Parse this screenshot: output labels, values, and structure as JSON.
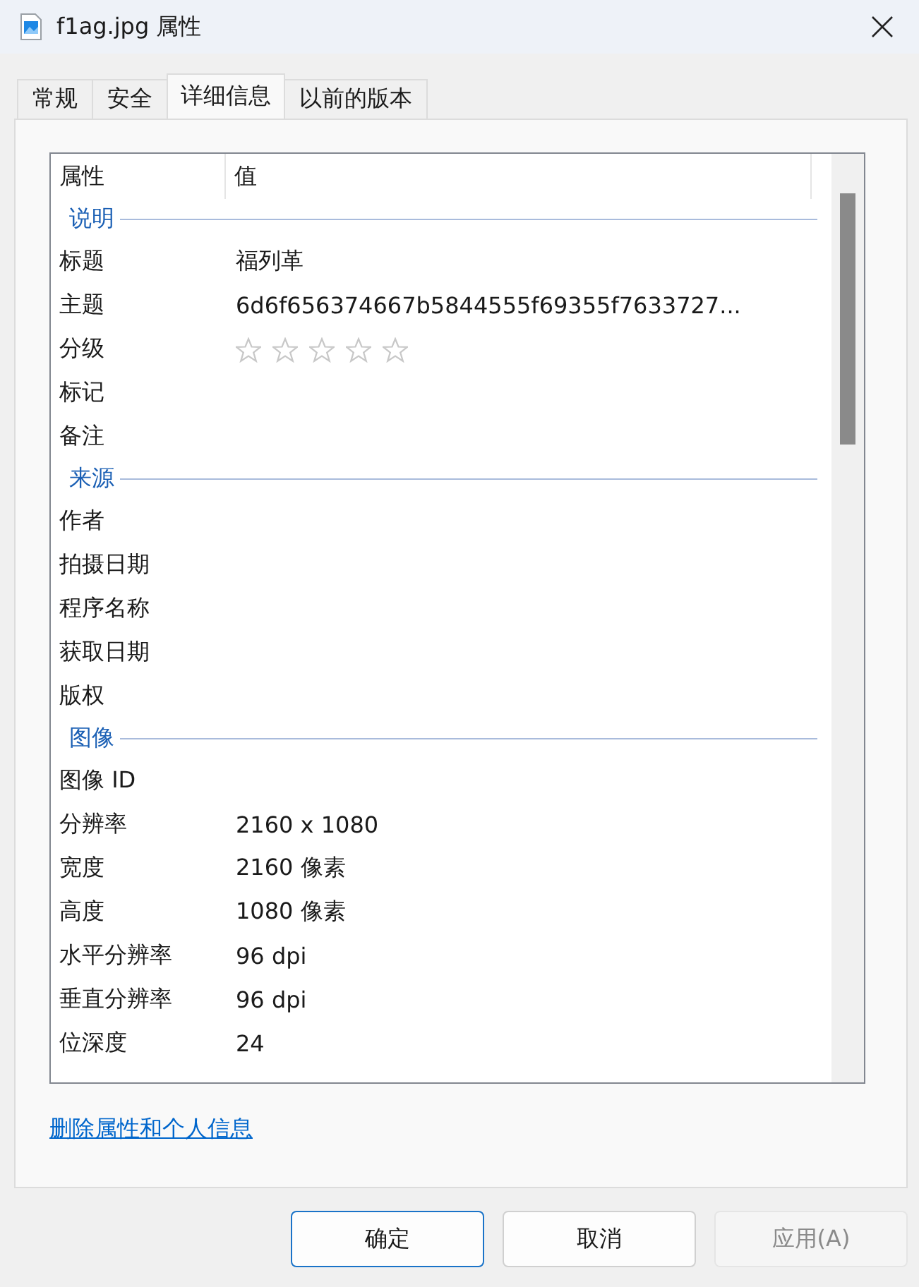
{
  "window": {
    "title": "f1ag.jpg 属性"
  },
  "tabs": [
    {
      "label": "常规",
      "selected": false
    },
    {
      "label": "安全",
      "selected": false
    },
    {
      "label": "详细信息",
      "selected": true
    },
    {
      "label": "以前的版本",
      "selected": false
    }
  ],
  "table": {
    "columns": [
      "属性",
      "值"
    ],
    "sections": [
      {
        "title": "说明",
        "rows": [
          {
            "name": "标题",
            "value": "福列革"
          },
          {
            "name": "主题",
            "value": "6d6f656374667b5844555f69355f7633727..."
          },
          {
            "name": "分级",
            "kind": "rating",
            "stars": 0
          },
          {
            "name": "标记"
          },
          {
            "name": "备注"
          }
        ]
      },
      {
        "title": "来源",
        "rows": [
          {
            "name": "作者"
          },
          {
            "name": "拍摄日期"
          },
          {
            "name": "程序名称"
          },
          {
            "name": "获取日期"
          },
          {
            "name": "版权"
          }
        ]
      },
      {
        "title": "图像",
        "rows": [
          {
            "name": "图像 ID"
          },
          {
            "name": "分辨率",
            "value": "2160 x 1080"
          },
          {
            "name": "宽度",
            "value": "2160 像素"
          },
          {
            "name": "高度",
            "value": "1080 像素"
          },
          {
            "name": "水平分辨率",
            "value": "96 dpi"
          },
          {
            "name": "垂直分辨率",
            "value": "96 dpi"
          },
          {
            "name": "位深度",
            "value": "24"
          }
        ]
      }
    ]
  },
  "link": "删除属性和个人信息",
  "buttons": [
    {
      "label": "确定",
      "default": true,
      "disabled": false
    },
    {
      "label": "取消",
      "default": false,
      "disabled": false
    },
    {
      "label": "应用(A)",
      "default": false,
      "disabled": true
    }
  ]
}
